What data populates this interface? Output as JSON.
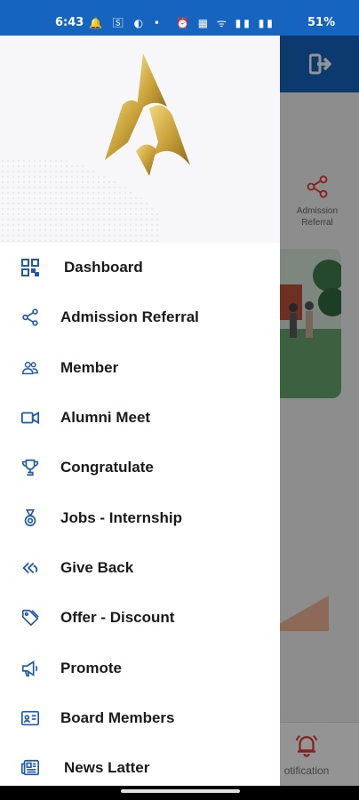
{
  "status_bar": {
    "time": "6:43",
    "left_icons": "🔔 🅂 ◐ •",
    "right_icons": "⏰ ▦ ᯤ ▮▮ ▮▮",
    "battery": "51%"
  },
  "background_app": {
    "referral_label": "Admission Referral",
    "notification_label": "otification"
  },
  "drawer": {
    "menu": [
      {
        "label": "Dashboard",
        "icon": "dashboard-icon"
      },
      {
        "label": "Admission Referral",
        "icon": "share-icon"
      },
      {
        "label": "Member",
        "icon": "member-icon"
      },
      {
        "label": "Alumni Meet",
        "icon": "video-icon"
      },
      {
        "label": "Congratulate",
        "icon": "trophy-icon"
      },
      {
        "label": "Jobs - Internship",
        "icon": "medal-icon"
      },
      {
        "label": "Give Back",
        "icon": "give-back-icon"
      },
      {
        "label": "Offer - Discount",
        "icon": "tag-icon"
      },
      {
        "label": "Promote",
        "icon": "megaphone-icon"
      },
      {
        "label": "Board Members",
        "icon": "id-card-icon"
      },
      {
        "label": "News Latter",
        "icon": "newspaper-icon"
      }
    ]
  },
  "colors": {
    "accent": "#1565c0",
    "icon": "#1e5aa8",
    "logo_gold": "#c9a23a",
    "alert": "#e53935"
  }
}
